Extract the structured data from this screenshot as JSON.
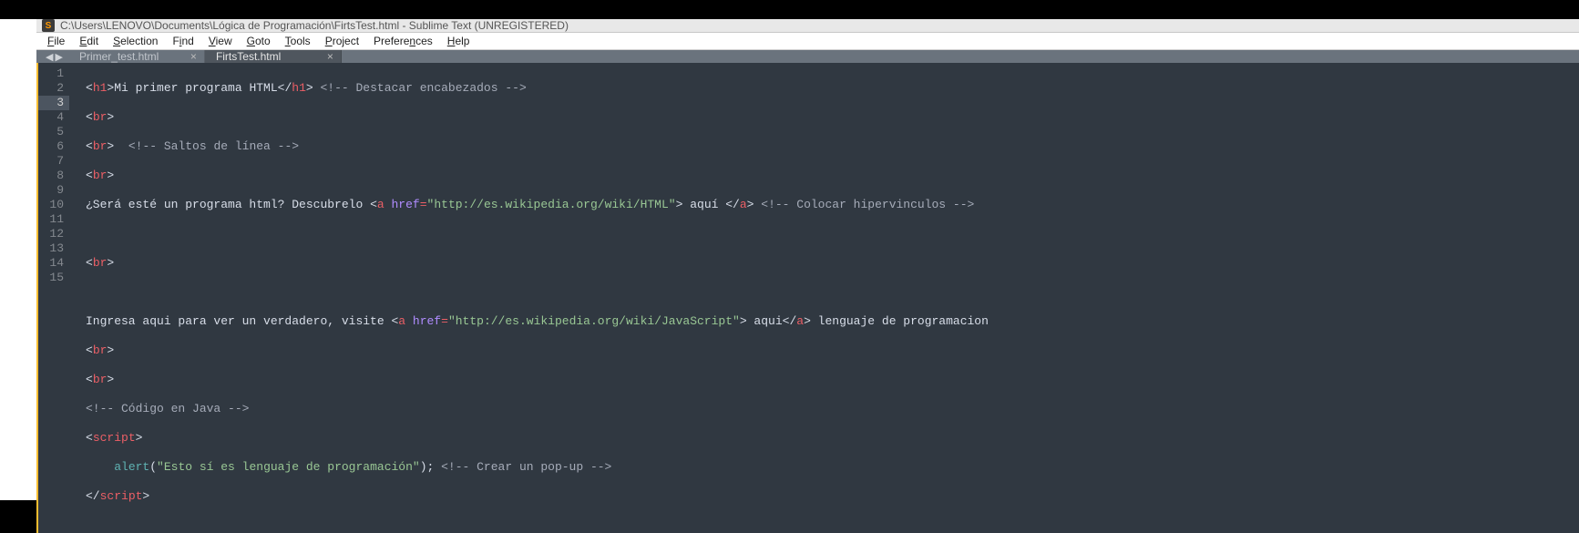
{
  "title": {
    "path": "C:\\Users\\LENOVO\\Documents\\Lógica de Programación\\FirtsTest.html - Sublime Text (UNREGISTERED)"
  },
  "menu": {
    "file": "File",
    "edit": "Edit",
    "selection": "Selection",
    "find": "Find",
    "view": "View",
    "goto": "Goto",
    "tools": "Tools",
    "project": "Project",
    "preferences": "Preferences",
    "help": "Help"
  },
  "tabs": {
    "primer": "Primer_test.html",
    "firts": "FirtsTest.html"
  },
  "gutter": {
    "l1": "1",
    "l2": "2",
    "l3": "3",
    "l4": "4",
    "l5": "5",
    "l6": "6",
    "l7": "7",
    "l8": "8",
    "l9": "9",
    "l10": "10",
    "l11": "11",
    "l12": "12",
    "l13": "13",
    "l14": "14",
    "l15": "15"
  },
  "code": {
    "h1_open_l": "<",
    "h1_open": "h1",
    "h1_open_r": ">",
    "h1_text": "Mi primer programa HTML",
    "h1_close_l": "</",
    "h1_close": "h1",
    "h1_close_r": ">",
    "c1": " <!-- Destacar encabezados -->",
    "br_l": "<",
    "br": "br",
    "br_r": ">",
    "c2": "  <!-- Saltos de línea -->",
    "line5_pre": "¿Será esté un programa html? Descubrelo ",
    "a_l": "<",
    "a": "a",
    "sp": " ",
    "href": "href",
    "eq": "=",
    "q": "\"",
    "url1": "http://es.wikipedia.org/wiki/HTML",
    "a_r": ">",
    "a_txt1": " aquí ",
    "a_cl_l": "</",
    "a_cl_r": ">",
    "c3": " <!-- Colocar hipervinculos -->",
    "line9_pre": "Ingresa aqui para ver un verdadero, visite ",
    "url2": "http://es.wikipedia.org/wiki/JavaScript",
    "a_txt2": " aqui",
    "line9_post": " lenguaje de programacion",
    "c4": "<!-- Código en Java -->",
    "script_open_l": "<",
    "script": "script",
    "script_open_r": ">",
    "indent": "    ",
    "alert": "alert",
    "paren_l": "(",
    "str": "\"Esto sí es lenguaje de programación\"",
    "paren_r": ")",
    "semi": ";",
    "c5": " <!-- Crear un pop-up -->",
    "script_close_l": "</",
    "script_close_r": ">"
  }
}
